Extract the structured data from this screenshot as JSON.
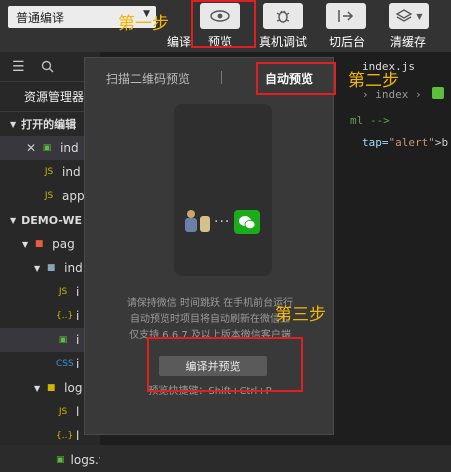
{
  "toolbar": {
    "mode_select": "普通编译",
    "buttons": [
      {
        "label": "编译",
        "icon": "compile-icon"
      },
      {
        "label": "预览",
        "icon": "eye-icon"
      },
      {
        "label": "真机调试",
        "icon": "bug-icon"
      },
      {
        "label": "切后台",
        "icon": "switch-background-icon"
      },
      {
        "label": "清缓存",
        "icon": "layers-icon"
      }
    ]
  },
  "annotations": {
    "step1": "第一步",
    "step2": "第二步",
    "step3": "第三步"
  },
  "sidebar": {
    "header": "资源管理器",
    "open_editors": "打开的编辑",
    "open_files": [
      "ind",
      "ind",
      "app"
    ],
    "project": "DEMO-WE",
    "tree": [
      {
        "label": "pag",
        "type": "folder-red"
      },
      {
        "label": "ind",
        "type": "folder"
      },
      {
        "label": "i",
        "type": "js"
      },
      {
        "label": "i",
        "type": "json"
      },
      {
        "label": "i",
        "type": "wxml"
      },
      {
        "label": "i",
        "type": "wxss"
      },
      {
        "label": "log",
        "type": "folder"
      },
      {
        "label": "l",
        "type": "js"
      },
      {
        "label": "l",
        "type": "json"
      },
      {
        "label": "logs.wxml",
        "type": "wxml"
      }
    ]
  },
  "editor": {
    "tab": "index.js",
    "breadcrumb": "index",
    "line1": "ml -->",
    "line2_attr": "tap=",
    "line2_value": "\"alert\"",
    "line2_tail": ">b"
  },
  "popup": {
    "tab_qr": "扫描二维码预览",
    "tab_auto": "自动预览",
    "desc": [
      "请保持微信 时间跳跃 在手机前台运行",
      "自动预览时项目将自动刷新在微信上",
      "仅支持 6.6.7 及以上版本微信客户端"
    ],
    "button": "编译并预览",
    "shortcut": "预览快捷键：Shift+Ctrl+P"
  },
  "colors": {
    "annotation": "#f2b705",
    "highlight_box": "#e02020",
    "wechat_green": "#1aad19"
  }
}
